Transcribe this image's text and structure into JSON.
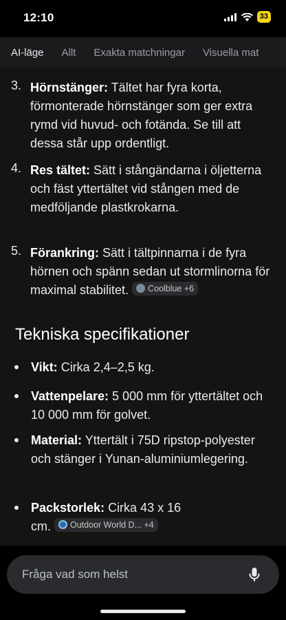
{
  "status_bar": {
    "time": "12:10",
    "battery": "33",
    "icons": [
      "signal-icon",
      "wifi-icon",
      "battery-icon"
    ]
  },
  "tabs": [
    {
      "label": "AI-läge",
      "active": true
    },
    {
      "label": "Allt",
      "active": false
    },
    {
      "label": "Exakta matchningar",
      "active": false
    },
    {
      "label": "Visuella mat",
      "active": false
    }
  ],
  "steps": [
    {
      "number": "3.",
      "title": "Hörnstänger:",
      "text": " Tältet har fyra korta, förmonterade hörnstänger som ger extra rymd vid huvud- och fotända. Se till att dessa står upp ordentligt."
    },
    {
      "number": "4.",
      "title": "Res tältet:",
      "text": " Sätt i stångändarna i öljetterna och fäst yttertältet vid stången med de medföljande plastkrokarna."
    },
    {
      "number": "5.",
      "title": "Förankring:",
      "text": " Sätt i tältpinnarna i de fyra hörnen och spänn sedan ut stormlinorna för maximal stabilitet. ",
      "source": "Coolblue +6"
    }
  ],
  "section_heading": "Tekniska specifikationer",
  "specs": [
    {
      "title": "Vikt:",
      "text": " Cirka 2,4–2,5 kg."
    },
    {
      "title": "Vattenpelare:",
      "text": " 5 000 mm för yttertältet och 10 000 mm för golvet."
    },
    {
      "title": "Material:",
      "text": " Yttertält i 75D ripstop-polyester och stänger i Yunan-aluminiumlegering."
    },
    {
      "title": "Packstorlek:",
      "text": " Cirka 43 x 16 cm. ",
      "source": "Outdoor World D... +4"
    }
  ],
  "ask_bar": {
    "placeholder": "Fråga vad som helst",
    "icon": "mic-icon"
  },
  "colors": {
    "background": "#141414",
    "tab_bar": "#1b1b1d",
    "chip": "#2a2b2e",
    "battery": "#f4d51b"
  }
}
